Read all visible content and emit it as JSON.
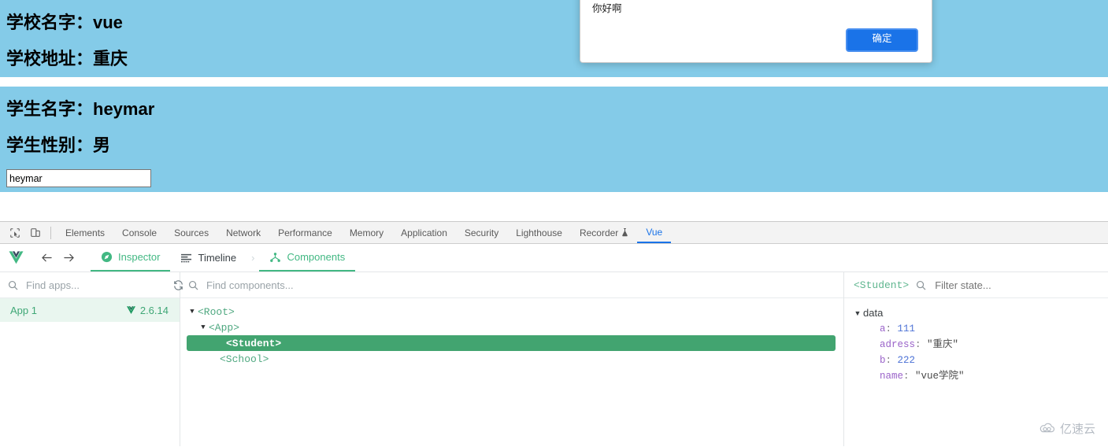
{
  "page": {
    "school": {
      "name_line": "学校名字：vue",
      "address_line": "学校地址：重庆"
    },
    "student": {
      "name_line": "学生名字：heymar",
      "gender_line": "学生性别：男",
      "input_value": "heymar",
      "input_placeholder": ""
    }
  },
  "dialog": {
    "message": "你好啊",
    "ok_label": "确定"
  },
  "devtools": {
    "tabs": [
      {
        "label": "Elements",
        "active": false
      },
      {
        "label": "Console",
        "active": false
      },
      {
        "label": "Sources",
        "active": false
      },
      {
        "label": "Network",
        "active": false
      },
      {
        "label": "Performance",
        "active": false
      },
      {
        "label": "Memory",
        "active": false
      },
      {
        "label": "Application",
        "active": false
      },
      {
        "label": "Security",
        "active": false
      },
      {
        "label": "Lighthouse",
        "active": false
      },
      {
        "label": "Recorder",
        "active": false
      },
      {
        "label": "Vue",
        "active": true
      }
    ],
    "icons": {
      "inspect": "inspect-element-icon",
      "device": "device-toolbar-icon",
      "recorder_badge": "experiment-flask-icon"
    }
  },
  "vue": {
    "toolbar": {
      "logo": "vue-logo-icon",
      "back": "arrow-left-icon",
      "forward": "arrow-right-icon",
      "inspector_label": "Inspector",
      "timeline_label": "Timeline",
      "chevron": "›",
      "components_label": "Components"
    },
    "apps_pane": {
      "search_placeholder": "Find apps...",
      "search_value": "",
      "refresh_icon": "refresh-icon",
      "apps": [
        {
          "name": "App 1",
          "version": "2.6.14",
          "selected": true
        }
      ]
    },
    "components_pane": {
      "search_placeholder": "Find components...",
      "search_value": "",
      "tree": [
        {
          "label": "<Root>",
          "depth": 0,
          "expanded": true,
          "selected": false
        },
        {
          "label": "<App>",
          "depth": 1,
          "expanded": true,
          "selected": false
        },
        {
          "label": "<Student>",
          "depth": 2,
          "expanded": null,
          "selected": true
        },
        {
          "label": "<School>",
          "depth": 2,
          "expanded": null,
          "selected": false
        }
      ]
    },
    "state_pane": {
      "component_name": "<Student>",
      "filter_placeholder": "Filter state...",
      "filter_value": "",
      "group_label": "data",
      "entries": [
        {
          "key": "a",
          "value": "111",
          "kind": "number"
        },
        {
          "key": "adress",
          "value": "\"重庆\"",
          "kind": "string"
        },
        {
          "key": "b",
          "value": "222",
          "kind": "number"
        },
        {
          "key": "name",
          "value": "\"vue学院\"",
          "kind": "string"
        }
      ]
    }
  },
  "watermark": {
    "text": "亿速云",
    "icon": "cloud-glasses-icon"
  },
  "colors": {
    "page_blue": "#84cbe8",
    "vue_green": "#42b883",
    "tree_selected": "#42a470",
    "devtools_accent": "#1a73e8",
    "dialog_button": "#1a73e8"
  }
}
